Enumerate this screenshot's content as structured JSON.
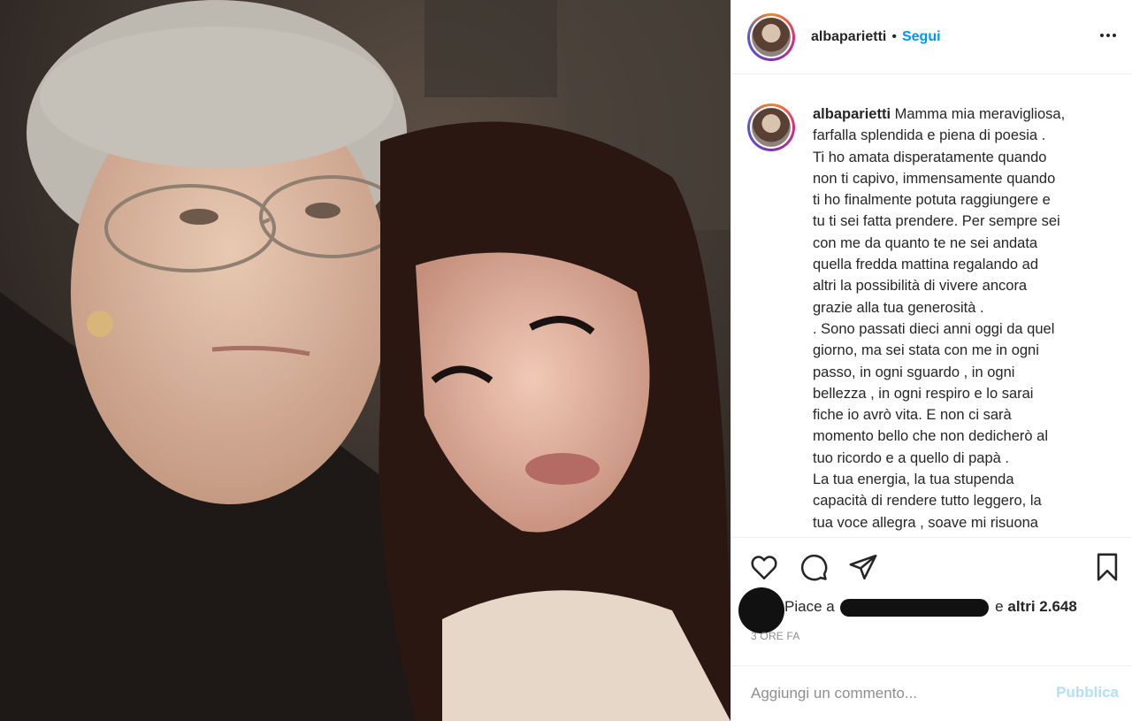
{
  "post": {
    "username": "albaparietti",
    "dot": "•",
    "follow_label": "Segui",
    "caption_lines": [
      "Mamma mia meravigliosa,",
      "farfalla splendida e piena di poesia .",
      "Ti ho amata disperatamente quando",
      "non ti capivo, immensamente quando",
      "ti ho finalmente potuta raggiungere e",
      "tu ti sei fatta prendere. Per sempre sei",
      "con me da quanto te ne sei andata",
      "quella fredda mattina regalando ad",
      "altri la possibilità di vivere ancora",
      "grazie alla tua generosità .",
      ". Sono passati dieci anni oggi da quel",
      "giorno, ma sei stata con me in ogni",
      "passo, in ogni sguardo , in ogni",
      "bellezza , in ogni respiro e lo sarai",
      "fiche io avrò vita. E non ci sarà",
      "momento bello che non dedicherò al",
      "tuo ricordo e a quello di papà .",
      "La tua energia, la tua stupenda",
      "capacità di rendere tutto leggero, la",
      "tua voce allegra , soave mi risuona"
    ],
    "likes_prefix": "Piace a",
    "likes_suffix": "e",
    "likes_others": "altri 2.648",
    "time_ago": "3 ORE FA",
    "comment_placeholder": "Aggiungi un commento...",
    "publish_label": "Pubblica"
  },
  "icons": {
    "more": "more-options-icon",
    "like": "heart-icon",
    "comment": "comment-icon",
    "share": "share-icon",
    "save": "bookmark-icon"
  },
  "colors": {
    "accent": "#0095f6",
    "publish_disabled": "#b2dffc",
    "text": "#262626",
    "muted": "#8e8e8e"
  }
}
